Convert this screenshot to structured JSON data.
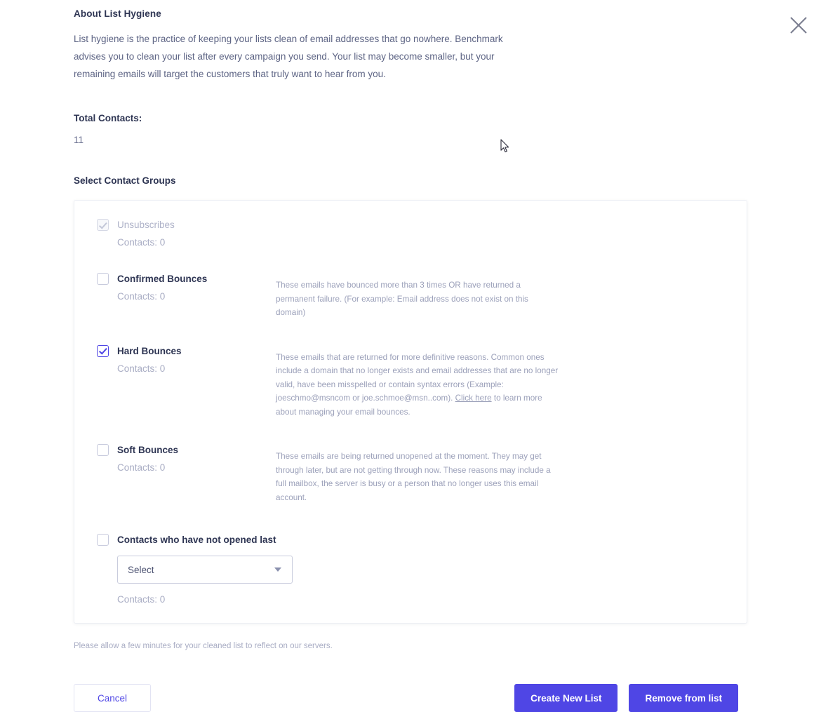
{
  "close_icon": "close-icon",
  "header": {
    "title": "About List Hygiene",
    "description": "List hygiene is the practice of keeping your lists clean of email addresses that go nowhere. Benchmark advises you to clean your list after every campaign you send. Your list may become smaller, but your remaining emails will target the customers that truly want to hear from you."
  },
  "total_contacts": {
    "label": "Total Contacts:",
    "value": "11"
  },
  "groups_section": {
    "title": "Select Contact Groups",
    "items": [
      {
        "name": "Unsubscribes",
        "checked": true,
        "disabled": true,
        "count_label": "Contacts: 0",
        "description": ""
      },
      {
        "name": "Confirmed Bounces",
        "checked": false,
        "disabled": false,
        "count_label": "Contacts: 0",
        "description": "These emails have bounced more than 3 times OR have returned a permanent failure. (For example: Email address does not exist on this domain)"
      },
      {
        "name": "Hard Bounces",
        "checked": true,
        "disabled": false,
        "count_label": "Contacts: 0",
        "description_part1": "These emails that are returned for more definitive reasons. Common ones include a domain that no longer exists and email addresses that are no longer valid, have been misspelled or contain syntax errors (Example: joeschmo@msncom or joe.schmoe@msn..com). ",
        "link_text": "Click here",
        "description_part2": " to learn more about managing your email bounces."
      },
      {
        "name": "Soft Bounces",
        "checked": false,
        "disabled": false,
        "count_label": "Contacts: 0",
        "description": "These emails are being returned unopened at the moment. They may get through later, but are not getting through now. These reasons may include a full mailbox, the server is busy or a person that no longer uses this email account."
      },
      {
        "name": "Contacts who have not opened last",
        "checked": false,
        "disabled": false,
        "count_label": "Contacts: 0",
        "select_value": "Select",
        "description": ""
      }
    ]
  },
  "footer": {
    "note": "Please allow a few minutes for your cleaned list to reflect on our servers.",
    "cancel_label": "Cancel",
    "create_label": "Create New List",
    "remove_label": "Remove from list"
  },
  "colors": {
    "accent": "#4f46e5",
    "heading": "#2e3553",
    "body_text": "#5d6484",
    "muted_text": "#9ca1ba",
    "card_border": "#eceef4"
  }
}
